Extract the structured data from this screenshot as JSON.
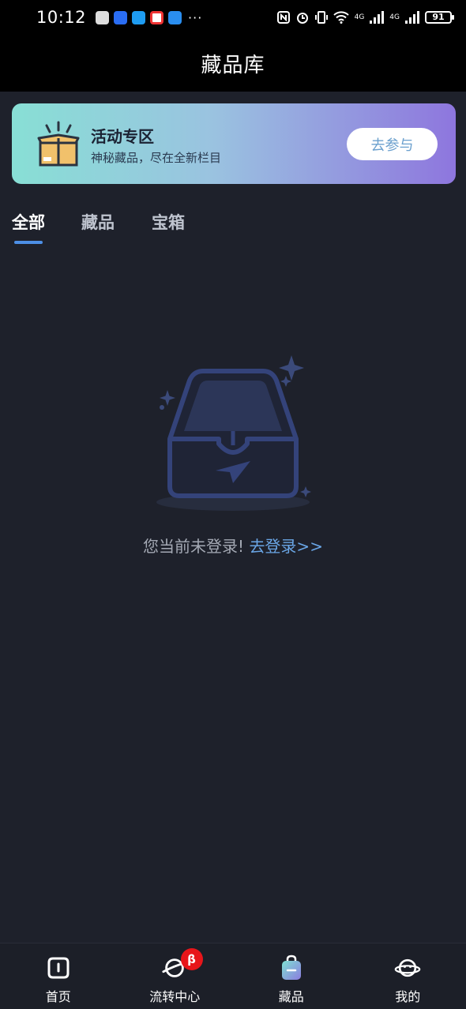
{
  "status_bar": {
    "time": "10:12",
    "more": "···",
    "network_1": "4G",
    "network_2": "4G",
    "battery": "91"
  },
  "header": {
    "title": "藏品库"
  },
  "banner": {
    "title": "活动专区",
    "subtitle": "神秘藏品，尽在全新栏目",
    "button_label": "去参与",
    "icon": "gift-box-icon"
  },
  "tabs": [
    {
      "label": "全部",
      "active": true
    },
    {
      "label": "藏品",
      "active": false
    },
    {
      "label": "宝箱",
      "active": false
    }
  ],
  "empty_state": {
    "message": "您当前未登录!",
    "link": "去登录>>",
    "illustration": "empty-inbox-icon"
  },
  "bottom_nav": {
    "items": [
      {
        "label": "首页",
        "icon": "home-icon"
      },
      {
        "label": "流转中心",
        "icon": "planet-icon",
        "badge": "β"
      },
      {
        "label": "藏品",
        "icon": "collection-bag-icon",
        "active": true
      },
      {
        "label": "我的",
        "icon": "profile-planet-icon"
      }
    ]
  },
  "colors": {
    "background": "#1e212b",
    "accent": "#4d8fe6",
    "link": "#6aa6e6",
    "badge": "#e7151a"
  }
}
